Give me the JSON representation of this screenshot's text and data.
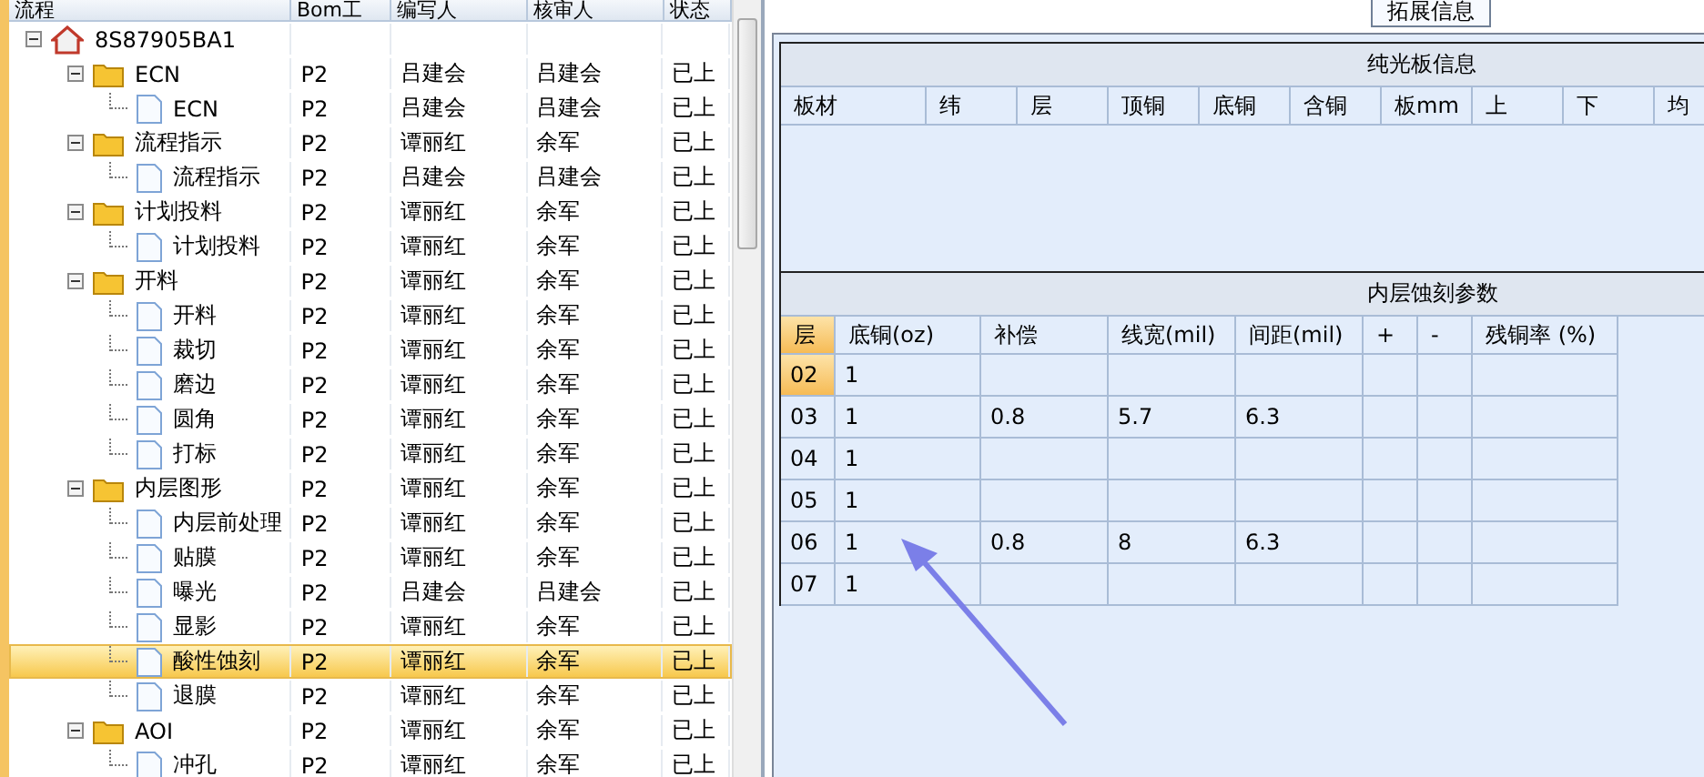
{
  "tree_columns": [
    "流程",
    "Bom工",
    "编写人",
    "核审人",
    "状态"
  ],
  "tree": [
    {
      "kind": "root",
      "label": "8S87905BA1",
      "expanded": true,
      "selected": false,
      "children": [
        {
          "kind": "folder",
          "label": "ECN",
          "bom": "P2",
          "author": "吕建会",
          "reviewer": "吕建会",
          "status": "已上",
          "expanded": true,
          "selected": false,
          "children": [
            {
              "kind": "step",
              "label": "ECN",
              "bom": "P2",
              "author": "吕建会",
              "reviewer": "吕建会",
              "status": "已上",
              "selected": false
            }
          ]
        },
        {
          "kind": "folder",
          "label": "流程指示",
          "bom": "P2",
          "author": "谭丽红",
          "reviewer": "余军",
          "status": "已上",
          "expanded": true,
          "selected": false,
          "children": [
            {
              "kind": "step",
              "label": "流程指示",
              "bom": "P2",
              "author": "吕建会",
              "reviewer": "吕建会",
              "status": "已上",
              "selected": false
            }
          ]
        },
        {
          "kind": "folder",
          "label": "计划投料",
          "bom": "P2",
          "author": "谭丽红",
          "reviewer": "余军",
          "status": "已上",
          "expanded": true,
          "selected": false,
          "children": [
            {
              "kind": "step",
              "label": "计划投料",
              "bom": "P2",
              "author": "谭丽红",
              "reviewer": "余军",
              "status": "已上",
              "selected": false
            }
          ]
        },
        {
          "kind": "folder",
          "label": "开料",
          "bom": "P2",
          "author": "谭丽红",
          "reviewer": "余军",
          "status": "已上",
          "expanded": true,
          "selected": false,
          "children": [
            {
              "kind": "step",
              "label": "开料",
              "bom": "P2",
              "author": "谭丽红",
              "reviewer": "余军",
              "status": "已上",
              "selected": false
            },
            {
              "kind": "step",
              "label": "裁切",
              "bom": "P2",
              "author": "谭丽红",
              "reviewer": "余军",
              "status": "已上",
              "selected": false
            },
            {
              "kind": "step",
              "label": "磨边",
              "bom": "P2",
              "author": "谭丽红",
              "reviewer": "余军",
              "status": "已上",
              "selected": false
            },
            {
              "kind": "step",
              "label": "圆角",
              "bom": "P2",
              "author": "谭丽红",
              "reviewer": "余军",
              "status": "已上",
              "selected": false
            },
            {
              "kind": "step",
              "label": "打标",
              "bom": "P2",
              "author": "谭丽红",
              "reviewer": "余军",
              "status": "已上",
              "selected": false
            }
          ]
        },
        {
          "kind": "folder",
          "label": "内层图形",
          "bom": "P2",
          "author": "谭丽红",
          "reviewer": "余军",
          "status": "已上",
          "expanded": true,
          "selected": false,
          "children": [
            {
              "kind": "step",
              "label": "内层前处理",
              "bom": "P2",
              "author": "谭丽红",
              "reviewer": "余军",
              "status": "已上",
              "selected": false
            },
            {
              "kind": "step",
              "label": "贴膜",
              "bom": "P2",
              "author": "谭丽红",
              "reviewer": "余军",
              "status": "已上",
              "selected": false
            },
            {
              "kind": "step",
              "label": "曝光",
              "bom": "P2",
              "author": "吕建会",
              "reviewer": "吕建会",
              "status": "已上",
              "selected": false
            },
            {
              "kind": "step",
              "label": "显影",
              "bom": "P2",
              "author": "谭丽红",
              "reviewer": "余军",
              "status": "已上",
              "selected": false
            },
            {
              "kind": "step",
              "label": "酸性蚀刻",
              "bom": "P2",
              "author": "谭丽红",
              "reviewer": "余军",
              "status": "已上",
              "selected": true
            },
            {
              "kind": "step",
              "label": "退膜",
              "bom": "P2",
              "author": "谭丽红",
              "reviewer": "余军",
              "status": "已上",
              "selected": false
            }
          ]
        },
        {
          "kind": "folder",
          "label": "AOI",
          "bom": "P2",
          "author": "谭丽红",
          "reviewer": "余军",
          "status": "已上",
          "expanded": true,
          "selected": false,
          "children": [
            {
              "kind": "step",
              "label": "冲孔",
              "bom": "P2",
              "author": "谭丽红",
              "reviewer": "余军",
              "status": "已上",
              "selected": false
            }
          ]
        }
      ]
    }
  ],
  "tab": {
    "label": "拓展信息",
    "selected": true
  },
  "bare_board": {
    "title": "纯光板信息",
    "columns": [
      "板材",
      "纬",
      "层",
      "顶铜",
      "底铜",
      "含铜",
      "板mm",
      "上",
      "下",
      "均"
    ]
  },
  "etch_params": {
    "title": "内层蚀刻参数",
    "columns": [
      "层",
      "底铜(oz)",
      "补偿",
      "线宽(mil)",
      "间距(mil)",
      "+",
      "-",
      "残铜率 (%)"
    ],
    "rows": [
      {
        "selected": true,
        "cells": [
          "02",
          "1",
          "",
          "",
          "",
          "",
          "",
          ""
        ]
      },
      {
        "selected": false,
        "cells": [
          "03",
          "1",
          "0.8",
          "5.7",
          "6.3",
          "",
          "",
          ""
        ]
      },
      {
        "selected": false,
        "cells": [
          "04",
          "1",
          "",
          "",
          "",
          "",
          "",
          ""
        ]
      },
      {
        "selected": false,
        "cells": [
          "05",
          "1",
          "",
          "",
          "",
          "",
          "",
          ""
        ]
      },
      {
        "selected": false,
        "cells": [
          "06",
          "1",
          "0.8",
          "8",
          "6.3",
          "",
          "",
          ""
        ]
      },
      {
        "selected": false,
        "cells": [
          "07",
          "1",
          "",
          "",
          "",
          "",
          "",
          ""
        ]
      }
    ]
  }
}
